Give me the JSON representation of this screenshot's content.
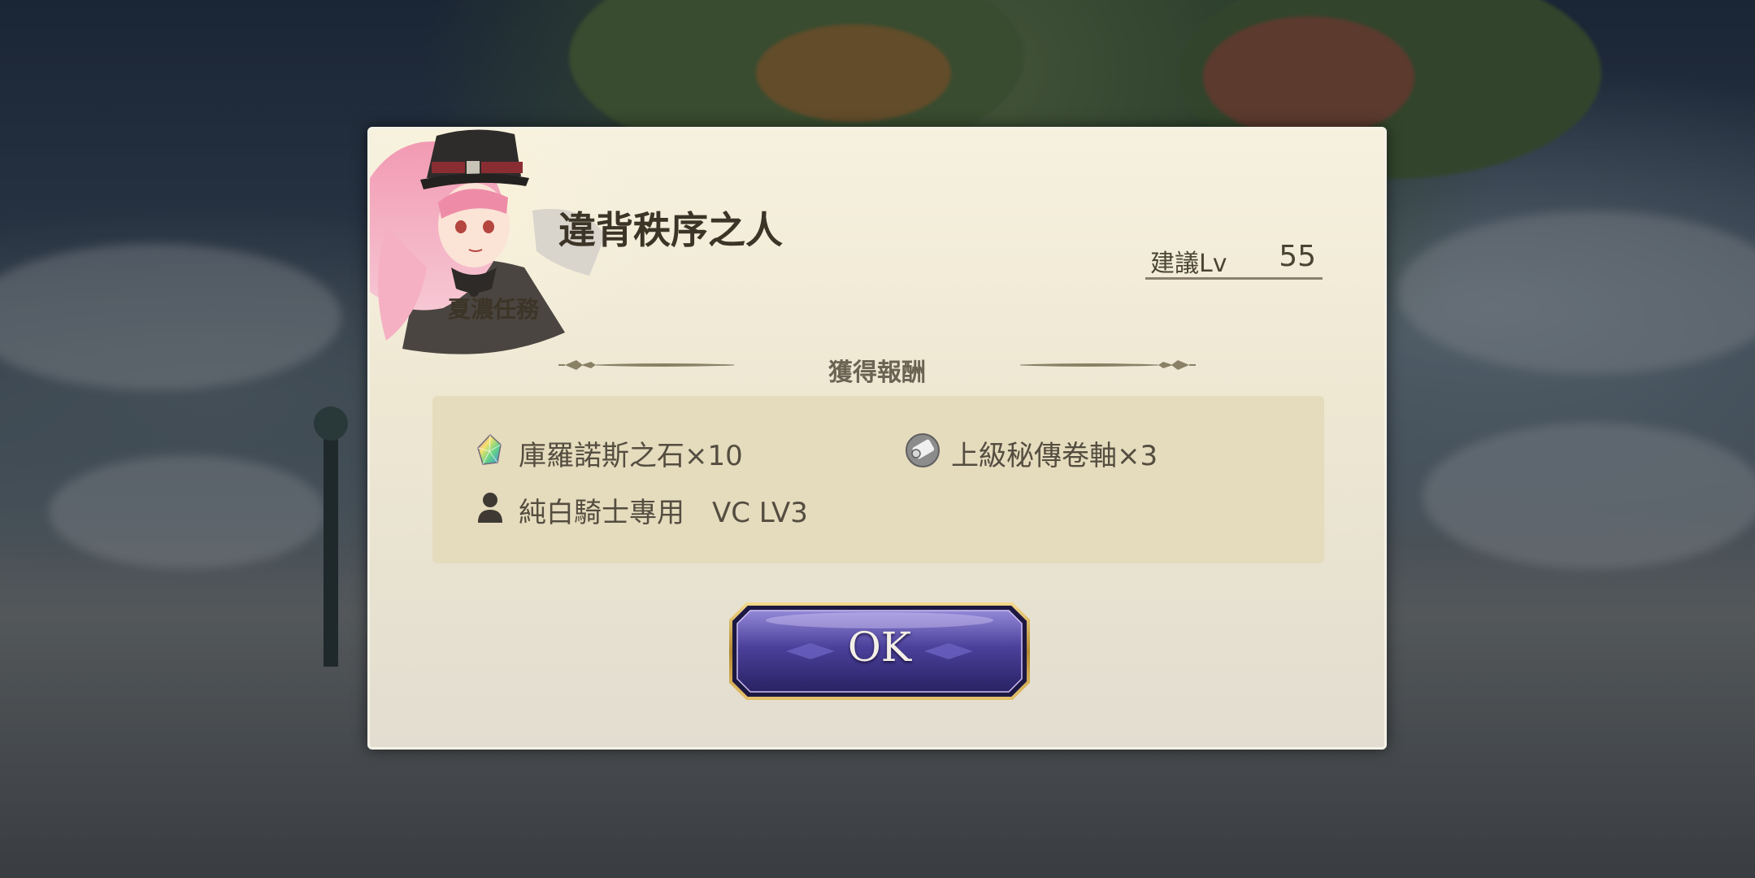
{
  "dialog": {
    "title": "違背秩序之人",
    "category": "夏濃任務",
    "recommended_level": {
      "label": "建議Lv",
      "value": "55"
    },
    "rewards_header": "獲得報酬",
    "rewards": [
      {
        "icon": "rainbow-crystal-icon",
        "text": "庫羅諾斯之石×10"
      },
      {
        "icon": "scroll-icon",
        "text": "上級秘傳卷軸×3"
      },
      {
        "icon": "person-icon",
        "text": "純白騎士專用　VC LV3"
      }
    ],
    "ok_label": "OK"
  },
  "colors": {
    "dialog_bg": "#f4efdd",
    "reward_panel_bg": "#e5dbbd",
    "text_dark": "#3c3427",
    "button_purple": "#4a3f8f",
    "button_gold": "#c9a24a"
  }
}
